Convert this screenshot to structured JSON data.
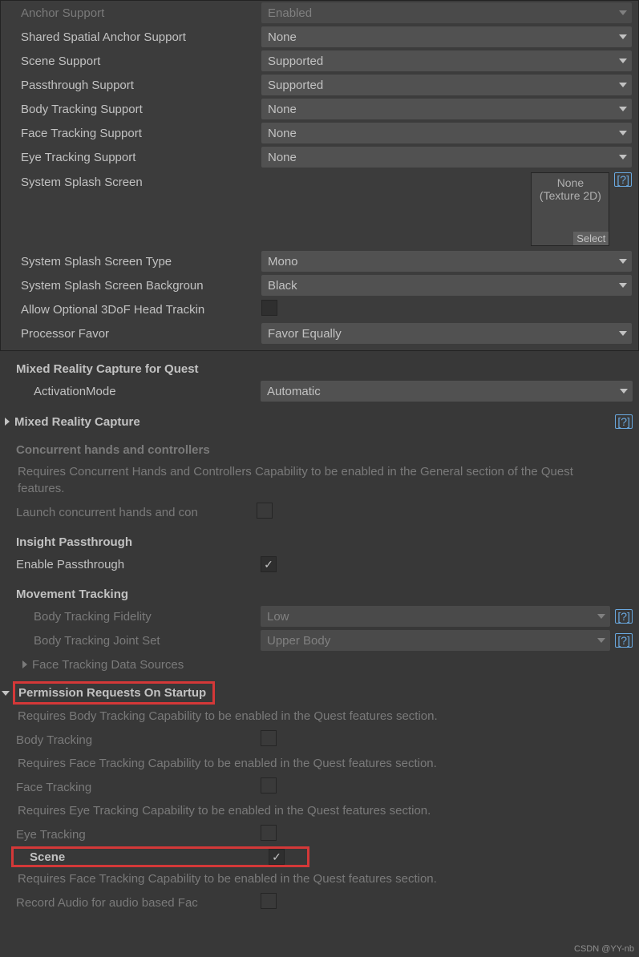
{
  "top": {
    "anchor_support": {
      "label": "Anchor Support",
      "value": "Enabled"
    },
    "shared_anchor": {
      "label": "Shared Spatial Anchor Support",
      "value": "None"
    },
    "scene_support": {
      "label": "Scene Support",
      "value": "Supported"
    },
    "passthrough_support": {
      "label": "Passthrough Support",
      "value": "Supported"
    },
    "body_tracking_support": {
      "label": "Body Tracking Support",
      "value": "None"
    },
    "face_tracking_support": {
      "label": "Face Tracking Support",
      "value": "None"
    },
    "eye_tracking_support": {
      "label": "Eye Tracking Support",
      "value": "None"
    },
    "splash_screen": {
      "label": "System Splash Screen",
      "picker_line1": "None",
      "picker_line2": "(Texture 2D)",
      "select": "Select",
      "help": "[?]"
    },
    "splash_type": {
      "label": "System Splash Screen Type",
      "value": "Mono"
    },
    "splash_bg": {
      "label": "System Splash Screen Backgroun",
      "value": "Black"
    },
    "allow_3dof": {
      "label": "Allow Optional 3DoF Head Trackin"
    },
    "processor_favor": {
      "label": "Processor Favor",
      "value": "Favor Equally"
    }
  },
  "mrc_quest": {
    "title": "Mixed Reality Capture for Quest",
    "activation": {
      "label": "ActivationMode",
      "value": "Automatic"
    }
  },
  "mrc": {
    "title": "Mixed Reality Capture",
    "help": "[?]"
  },
  "concurrent": {
    "title": "Concurrent hands and controllers",
    "info": "Requires Concurrent Hands and Controllers Capability to be enabled in the General section of the Quest features.",
    "launch_label": "Launch concurrent hands and con"
  },
  "insight": {
    "title": "Insight Passthrough",
    "enable_label": "Enable Passthrough"
  },
  "movement": {
    "title": "Movement Tracking",
    "fidelity": {
      "label": "Body Tracking Fidelity",
      "value": "Low",
      "help": "[?]"
    },
    "joint_set": {
      "label": "Body Tracking Joint Set",
      "value": "Upper Body",
      "help": "[?]"
    },
    "face_sources": "Face Tracking Data Sources"
  },
  "permissions": {
    "title": "Permission Requests On Startup",
    "body_req": "Requires Body Tracking Capability to be enabled in the Quest features section.",
    "body_label": "Body Tracking",
    "face_req": "Requires Face Tracking Capability to be enabled in the Quest features section.",
    "face_label": "Face Tracking",
    "eye_req": "Requires Eye Tracking Capability to be enabled in the Quest features section.",
    "eye_label": "Eye Tracking",
    "scene_label": "Scene",
    "audio_req": "Requires Face Tracking Capability to be enabled in the Quest features section.",
    "audio_label": "Record Audio for audio based Fac"
  },
  "watermark": "CSDN @YY-nb"
}
